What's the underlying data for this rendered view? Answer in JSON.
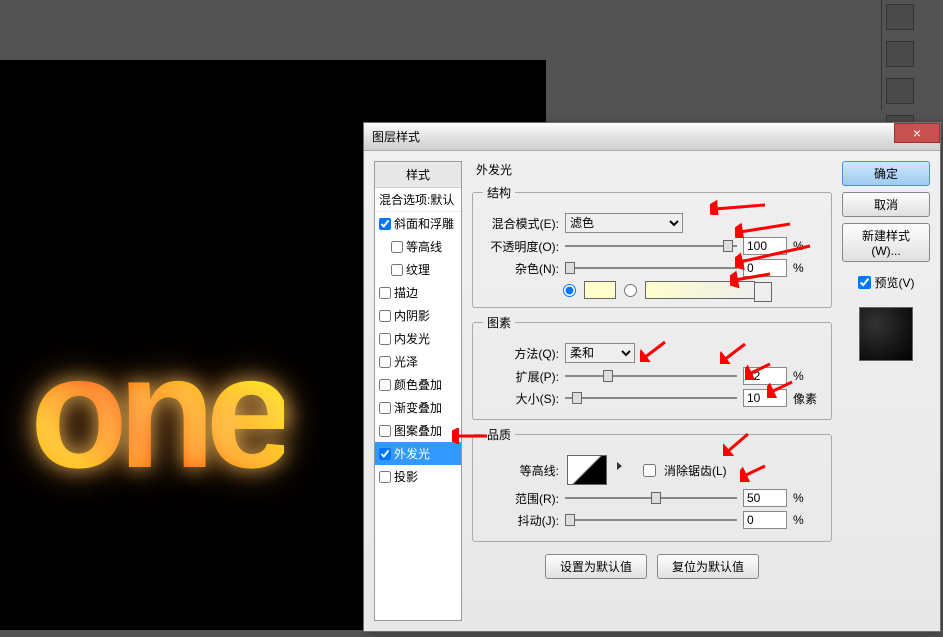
{
  "canvas": {
    "text": "one"
  },
  "dialog": {
    "title": "图层样式",
    "styles_header": "样式",
    "blend_default": "混合选项:默认",
    "style_items": [
      {
        "label": "斜面和浮雕",
        "checked": true
      },
      {
        "label": "等高线",
        "checked": false,
        "indent": true
      },
      {
        "label": "纹理",
        "checked": false,
        "indent": true
      },
      {
        "label": "描边",
        "checked": false
      },
      {
        "label": "内阴影",
        "checked": false
      },
      {
        "label": "内发光",
        "checked": false
      },
      {
        "label": "光泽",
        "checked": false
      },
      {
        "label": "颜色叠加",
        "checked": false
      },
      {
        "label": "渐变叠加",
        "checked": false
      },
      {
        "label": "图案叠加",
        "checked": false
      },
      {
        "label": "外发光",
        "checked": true,
        "selected": true
      },
      {
        "label": "投影",
        "checked": false
      }
    ],
    "section_title": "外发光",
    "structure": {
      "legend": "结构",
      "blend_mode_label": "混合模式(E):",
      "blend_mode_value": "滤色",
      "opacity_label": "不透明度(O):",
      "opacity_value": "100",
      "opacity_unit": "%",
      "noise_label": "杂色(N):",
      "noise_value": "0",
      "noise_unit": "%"
    },
    "elements": {
      "legend": "图素",
      "technique_label": "方法(Q):",
      "technique_value": "柔和",
      "spread_label": "扩展(P):",
      "spread_value": "22",
      "spread_unit": "%",
      "size_label": "大小(S):",
      "size_value": "10",
      "size_unit": "像素"
    },
    "quality": {
      "legend": "品质",
      "contour_label": "等高线:",
      "antialias_label": "消除锯齿(L)",
      "range_label": "范围(R):",
      "range_value": "50",
      "range_unit": "%",
      "jitter_label": "抖动(J):",
      "jitter_value": "0",
      "jitter_unit": "%"
    },
    "make_default": "设置为默认值",
    "reset_default": "复位为默认值",
    "buttons": {
      "ok": "确定",
      "cancel": "取消",
      "new_style": "新建样式(W)...",
      "preview": "预览(V)"
    }
  }
}
